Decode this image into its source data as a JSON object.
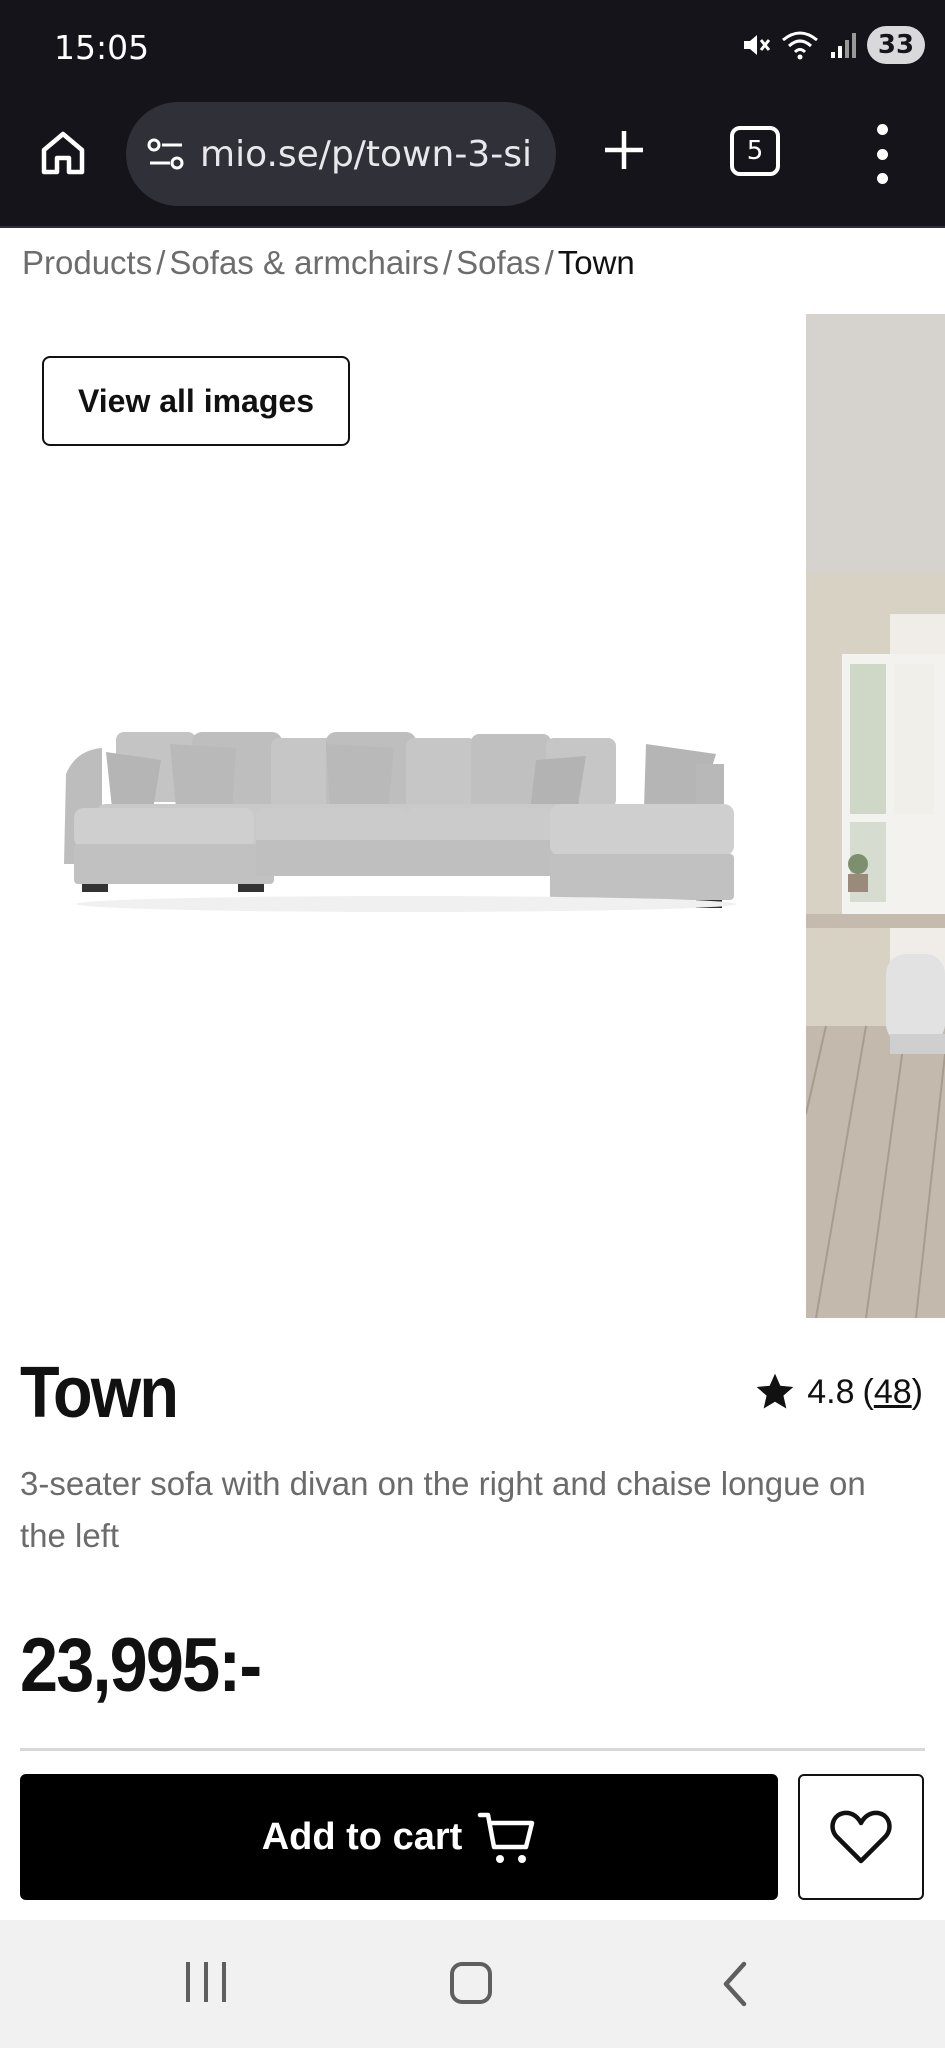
{
  "status_bar": {
    "time": "15:05",
    "battery": "33",
    "icons": [
      "mute-icon",
      "wifi-icon",
      "signal-icon",
      "battery-icon"
    ]
  },
  "browser": {
    "url": "mio.se/p/town-3-si",
    "tab_count": "5",
    "icons": [
      "home-icon",
      "site-settings-icon",
      "plus-icon",
      "tabs-icon",
      "more-vert-icon"
    ]
  },
  "breadcrumb": {
    "items": [
      "Products",
      "Sofas & armchairs",
      "Sofas",
      "Town"
    ],
    "separator": "/"
  },
  "gallery": {
    "view_all_label": "View all images"
  },
  "product": {
    "title": "Town",
    "rating": "4.8",
    "rating_count_open": "(",
    "rating_count": "48",
    "rating_count_close": ")",
    "description": "3-seater sofa with divan on the right and chaise longue on the left",
    "price": "23,995:-"
  },
  "actions": {
    "add_to_cart_label": "Add to cart",
    "icons": [
      "cart-icon",
      "heart-icon"
    ]
  },
  "colors": {
    "status_bar": "#14141a",
    "url_bar": "#303038",
    "button_primary": "#000000",
    "muted_text": "#6b6b6b",
    "sofa": "#c9c9c9"
  }
}
